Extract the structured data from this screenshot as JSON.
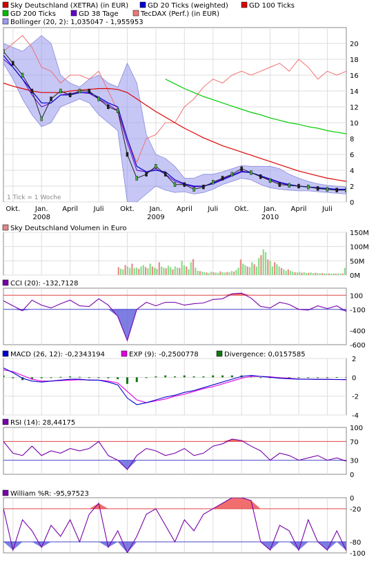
{
  "colors": {
    "price": "#ff0000",
    "gd20": "#0000cc",
    "gd100": "#dd0000",
    "gd200": "#00cc00",
    "gd38": "#6600cc",
    "tecdax": "#f07070",
    "bollinger": "#9999ee",
    "purple": "#7700aa",
    "volUp": "#88dd88",
    "volDown": "#ee8888",
    "macdBar": "#117711",
    "refRed": "#dd4444",
    "refBlue": "#4444cc"
  },
  "legend": [
    {
      "label": "Sky Deutschland (XETRA) (in EUR)",
      "color": "#cc0000"
    },
    {
      "label": "GD 20 Ticks (weighted)",
      "color": "#0000cc"
    },
    {
      "label": "GD 100 Ticks",
      "color": "#dd0000"
    },
    {
      "label": "GD 200 Ticks",
      "color": "#00bb00"
    },
    {
      "label": "GD 38 Tage",
      "color": "#6600cc"
    },
    {
      "label": "TecDAX (Perf.) (in EUR)",
      "color": "#ee7777"
    },
    {
      "label": "Bollinger (20, 2): 1,035047 - 1,955953",
      "color": "#9999ee"
    }
  ],
  "main_note": "1 Tick = 1 Woche",
  "x_axis": {
    "months": [
      "Okt.",
      "Jan.",
      "April",
      "Juli",
      "Okt.",
      "Jan.",
      "April",
      "Juli",
      "Okt.",
      "Jan.",
      "April",
      "Juli"
    ],
    "years": [
      "2008",
      "2009",
      "2010"
    ]
  },
  "panels": {
    "volume": {
      "label": "Sky Deutschland Volumen in Euro",
      "color": "#dd8888"
    },
    "cci": {
      "label": "CCI (20): -132,7128",
      "color": "#7700aa"
    },
    "macd": [
      {
        "label": "MACD (26, 12): -0,2343194",
        "color": "#0000cc"
      },
      {
        "label": "EXP (9): -0,2500778",
        "color": "#dd00dd"
      },
      {
        "label": "Divergence: 0,0157585",
        "color": "#117711"
      }
    ],
    "rsi": {
      "label": "RSI (14): 28,44175",
      "color": "#7700aa"
    },
    "williams": {
      "label": "William %R: -95,97523",
      "color": "#7700aa"
    }
  },
  "chart_data": [
    {
      "type": "line",
      "title": "Sky Deutschland (XETRA) (in EUR)",
      "ylim": [
        0,
        22
      ],
      "yticks": [
        0,
        2,
        4,
        6,
        8,
        10,
        12,
        14,
        16,
        18,
        20
      ],
      "x": [
        0,
        4,
        8,
        12,
        16,
        20,
        24,
        28,
        32,
        36,
        40,
        44,
        48,
        52,
        56,
        60,
        64,
        68,
        72,
        76,
        80,
        84,
        88,
        92,
        96,
        100,
        104,
        108,
        112,
        116,
        120,
        124,
        128,
        132,
        136,
        140,
        144
      ],
      "series": [
        {
          "name": "Sky Deutschland (XETRA) (in EUR)",
          "values": [
            19.0,
            17.5,
            16.0,
            14.0,
            10.5,
            13.0,
            14.0,
            13.5,
            14.0,
            14.0,
            13.0,
            12.0,
            11.5,
            6.0,
            3.0,
            3.5,
            4.5,
            3.5,
            2.2,
            2.2,
            1.6,
            1.9,
            2.5,
            3.0,
            3.5,
            4.2,
            3.7,
            3.2,
            2.7,
            2.2,
            2.1,
            2.0,
            1.9,
            1.7,
            1.6,
            1.5,
            1.5
          ]
        },
        {
          "name": "GD 20 Ticks (weighted)",
          "values": [
            18.5,
            17.0,
            15.5,
            14.0,
            12.5,
            12.5,
            13.5,
            13.5,
            13.8,
            13.8,
            13.2,
            12.5,
            12.0,
            8.0,
            4.5,
            3.8,
            4.0,
            3.8,
            2.8,
            2.3,
            2.0,
            2.0,
            2.3,
            2.8,
            3.3,
            3.8,
            3.7,
            3.3,
            2.9,
            2.5,
            2.2,
            2.0,
            1.9,
            1.8,
            1.7,
            1.6,
            1.6
          ]
        },
        {
          "name": "GD 100 Ticks",
          "values": [
            15.0,
            14.6,
            14.3,
            14.0,
            13.8,
            13.8,
            13.8,
            14.0,
            14.1,
            14.2,
            14.3,
            14.3,
            14.2,
            13.8,
            13.0,
            12.2,
            11.4,
            10.7,
            10.0,
            9.3,
            8.7,
            8.1,
            7.6,
            7.1,
            6.7,
            6.3,
            5.9,
            5.5,
            5.1,
            4.7,
            4.3,
            3.9,
            3.6,
            3.3,
            3.0,
            2.8,
            2.6
          ]
        },
        {
          "name": "GD 200 Ticks",
          "values": [
            null,
            null,
            null,
            null,
            null,
            null,
            null,
            null,
            null,
            null,
            null,
            null,
            null,
            null,
            null,
            null,
            null,
            15.5,
            14.9,
            14.3,
            13.8,
            13.3,
            12.9,
            12.5,
            12.1,
            11.7,
            11.3,
            11.0,
            10.6,
            10.3,
            10.0,
            9.8,
            9.5,
            9.3,
            9.0,
            8.8,
            8.6
          ]
        },
        {
          "name": "GD 38 Tage",
          "values": [
            18.0,
            17.0,
            15.5,
            13.5,
            12.0,
            12.5,
            13.5,
            13.7,
            13.8,
            13.7,
            13.0,
            12.3,
            11.5,
            7.5,
            4.0,
            3.8,
            4.2,
            3.5,
            2.6,
            2.2,
            1.9,
            2.0,
            2.4,
            2.9,
            3.4,
            3.9,
            3.7,
            3.2,
            2.8,
            2.4,
            2.1,
            2.0,
            1.9,
            1.7,
            1.6,
            1.5,
            1.5
          ]
        },
        {
          "name": "TecDAX (Perf.) (in EUR)",
          "values": [
            19.0,
            20.0,
            21.0,
            19.5,
            17.0,
            16.5,
            15.0,
            16.0,
            16.0,
            15.5,
            16.5,
            14.0,
            11.5,
            8.0,
            5.0,
            8.0,
            8.5,
            10.0,
            10.0,
            12.0,
            13.0,
            14.5,
            15.5,
            15.0,
            16.0,
            16.5,
            16.0,
            16.5,
            17.0,
            17.5,
            16.5,
            18.0,
            17.0,
            15.5,
            16.5,
            16.0,
            16.5
          ]
        },
        {
          "name": "Bollinger upper",
          "values": [
            20.0,
            19.5,
            19.0,
            20.0,
            21.0,
            20.0,
            16.0,
            15.0,
            14.5,
            15.5,
            16.0,
            15.0,
            14.5,
            17.5,
            15.0,
            8.5,
            6.0,
            5.5,
            4.5,
            3.0,
            3.0,
            3.5,
            3.5,
            3.8,
            4.2,
            4.6,
            4.5,
            4.5,
            4.5,
            4.2,
            3.5,
            3.0,
            2.6,
            2.3,
            2.1,
            2.0,
            1.9
          ]
        },
        {
          "name": "Bollinger lower",
          "values": [
            17.5,
            15.5,
            13.0,
            11.0,
            9.5,
            10.0,
            12.0,
            12.5,
            13.0,
            12.5,
            11.0,
            10.0,
            9.0,
            0.0,
            0.0,
            1.0,
            2.0,
            1.5,
            1.2,
            1.3,
            1.0,
            1.2,
            1.6,
            2.2,
            2.6,
            3.0,
            2.8,
            2.2,
            1.8,
            1.6,
            1.5,
            1.4,
            1.4,
            1.3,
            1.2,
            1.1,
            1.0
          ]
        }
      ]
    },
    {
      "type": "bar",
      "title": "Sky Deutschland Volumen in Euro",
      "ylim": [
        0,
        150
      ],
      "yticks": [
        {
          "v": 0,
          "l": "0M"
        },
        {
          "v": 50,
          "l": "50M"
        },
        {
          "v": 100,
          "l": "100M"
        },
        {
          "v": 150,
          "l": "150M"
        }
      ],
      "start": 48,
      "values": [
        28,
        22,
        20,
        35,
        30,
        25,
        40,
        24,
        26,
        22,
        30,
        35,
        28,
        24,
        40,
        30,
        26,
        22,
        45,
        30,
        26,
        24,
        33,
        28,
        20,
        30,
        26,
        25,
        50,
        34,
        30,
        20,
        45,
        56,
        26,
        15,
        14,
        12,
        10,
        9,
        8,
        12,
        10,
        9,
        8,
        13,
        10,
        9,
        11,
        10,
        14,
        12,
        18,
        26,
        55,
        40,
        35,
        30,
        28,
        45,
        38,
        30,
        60,
        70,
        90,
        80,
        55,
        50,
        30,
        45,
        38,
        30,
        25,
        20,
        15,
        20,
        15,
        12,
        10,
        9,
        11,
        8,
        10,
        7,
        8,
        9,
        7,
        8,
        7,
        6,
        7,
        6,
        5,
        6,
        5,
        6,
        5,
        6,
        5,
        6,
        25
      ]
    },
    {
      "type": "line",
      "title": "CCI (20)",
      "ylim": [
        -600,
        200
      ],
      "yticks": [
        100,
        -100,
        -400,
        -600
      ],
      "refs": [
        100,
        -100
      ],
      "x": [
        0,
        4,
        8,
        12,
        16,
        20,
        24,
        28,
        32,
        36,
        40,
        44,
        48,
        52,
        56,
        60,
        64,
        68,
        72,
        76,
        80,
        84,
        88,
        92,
        96,
        100,
        104,
        108,
        112,
        116,
        120,
        124,
        128,
        132,
        136,
        140,
        144
      ],
      "series": [
        {
          "name": "CCI (20)",
          "values": [
            20,
            -50,
            -120,
            30,
            -40,
            -80,
            -20,
            30,
            -50,
            -60,
            50,
            -40,
            -200,
            -540,
            -100,
            0,
            -50,
            0,
            0,
            -40,
            -20,
            -10,
            40,
            50,
            120,
            130,
            60,
            -60,
            -80,
            0,
            -30,
            -100,
            -110,
            -50,
            -90,
            -50,
            -130
          ]
        }
      ]
    },
    {
      "type": "line",
      "title": "MACD (26, 12)",
      "ylim": [
        -4,
        2
      ],
      "yticks": [
        2,
        0,
        -2,
        -4
      ],
      "x": [
        0,
        4,
        8,
        12,
        16,
        20,
        24,
        28,
        32,
        36,
        40,
        44,
        48,
        52,
        56,
        60,
        64,
        68,
        72,
        76,
        80,
        84,
        88,
        92,
        96,
        100,
        104,
        108,
        112,
        116,
        120,
        124,
        128,
        132,
        136,
        140,
        144
      ],
      "series": [
        {
          "name": "MACD (26, 12)",
          "values": [
            1.0,
            0.5,
            -0.1,
            -0.4,
            -0.5,
            -0.4,
            -0.3,
            -0.2,
            -0.2,
            -0.3,
            -0.3,
            -0.5,
            -0.8,
            -2.2,
            -2.9,
            -2.7,
            -2.4,
            -2.1,
            -1.9,
            -1.6,
            -1.4,
            -1.1,
            -0.8,
            -0.5,
            -0.2,
            0.1,
            0.2,
            0.1,
            0.0,
            -0.1,
            -0.15,
            -0.2,
            -0.2,
            -0.22,
            -0.22,
            -0.23,
            -0.23
          ]
        },
        {
          "name": "EXP (9)",
          "values": [
            0.8,
            0.6,
            0.2,
            -0.2,
            -0.4,
            -0.4,
            -0.35,
            -0.3,
            -0.25,
            -0.28,
            -0.3,
            -0.4,
            -0.6,
            -1.5,
            -2.4,
            -2.7,
            -2.5,
            -2.3,
            -2.0,
            -1.8,
            -1.5,
            -1.2,
            -1.0,
            -0.7,
            -0.4,
            -0.1,
            0.1,
            0.1,
            0.05,
            -0.05,
            -0.1,
            -0.18,
            -0.2,
            -0.21,
            -0.22,
            -0.24,
            -0.25
          ]
        },
        {
          "name": "Divergence",
          "values": [
            0.2,
            -0.1,
            -0.3,
            -0.2,
            -0.1,
            0.0,
            0.05,
            0.1,
            0.05,
            -0.02,
            0.0,
            -0.1,
            -0.2,
            -0.7,
            -0.5,
            0.0,
            0.1,
            0.2,
            0.1,
            0.2,
            0.1,
            0.1,
            0.2,
            0.2,
            0.2,
            0.2,
            0.1,
            0.0,
            -0.05,
            -0.05,
            -0.05,
            -0.02,
            0.0,
            -0.01,
            0.0,
            0.01,
            0.02
          ]
        }
      ]
    },
    {
      "type": "line",
      "title": "RSI (14)",
      "ylim": [
        0,
        100
      ],
      "yticks": [
        100,
        70,
        30,
        0
      ],
      "refs": [
        70,
        30
      ],
      "x": [
        0,
        4,
        8,
        12,
        16,
        20,
        24,
        28,
        32,
        36,
        40,
        44,
        48,
        52,
        56,
        60,
        64,
        68,
        72,
        76,
        80,
        84,
        88,
        92,
        96,
        100,
        104,
        108,
        112,
        116,
        120,
        124,
        128,
        132,
        136,
        140,
        144
      ],
      "series": [
        {
          "name": "RSI (14)",
          "values": [
            70,
            45,
            40,
            60,
            40,
            50,
            45,
            55,
            50,
            55,
            70,
            40,
            30,
            10,
            40,
            55,
            50,
            40,
            45,
            55,
            40,
            45,
            60,
            65,
            75,
            72,
            60,
            50,
            30,
            45,
            40,
            30,
            35,
            40,
            30,
            35,
            28
          ]
        }
      ]
    },
    {
      "type": "line",
      "title": "William %R",
      "ylim": [
        -100,
        0
      ],
      "yticks": [
        0,
        -20,
        -80,
        -100
      ],
      "refs": [
        -20,
        -80
      ],
      "x": [
        0,
        4,
        8,
        12,
        16,
        20,
        24,
        28,
        32,
        36,
        40,
        44,
        48,
        52,
        56,
        60,
        64,
        68,
        72,
        76,
        80,
        84,
        88,
        92,
        96,
        100,
        104,
        108,
        112,
        116,
        120,
        124,
        128,
        132,
        136,
        140,
        144
      ],
      "series": [
        {
          "name": "William %R",
          "values": [
            -20,
            -95,
            -40,
            -60,
            -90,
            -50,
            -70,
            -40,
            -80,
            -30,
            -10,
            -90,
            -60,
            -100,
            -70,
            -30,
            -20,
            -50,
            -80,
            -40,
            -60,
            -30,
            -20,
            -10,
            0,
            0,
            -5,
            -80,
            -95,
            -50,
            -60,
            -95,
            -40,
            -80,
            -95,
            -60,
            -96
          ]
        }
      ]
    }
  ]
}
